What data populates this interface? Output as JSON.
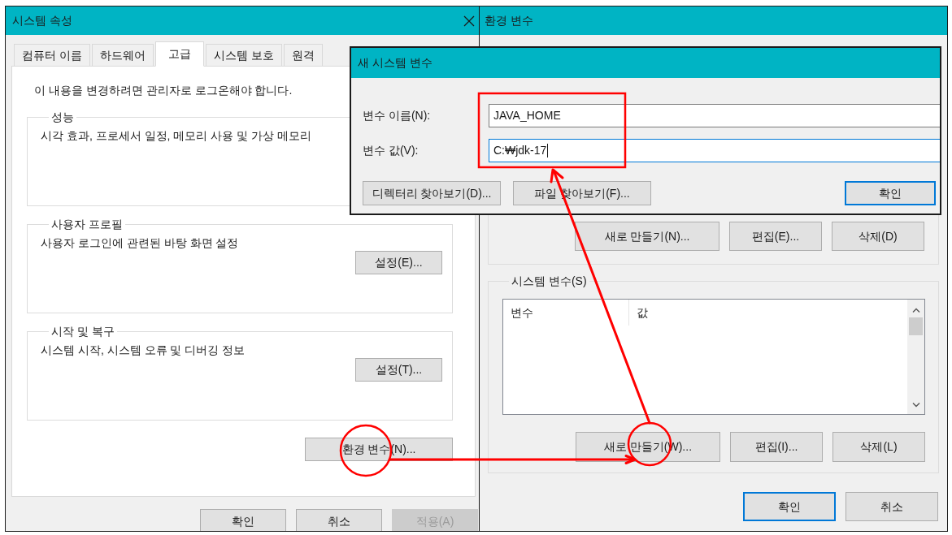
{
  "system_properties": {
    "title": "시스템 속성",
    "tabs": [
      {
        "label": "컴퓨터 이름",
        "selected": false
      },
      {
        "label": "하드웨어",
        "selected": false
      },
      {
        "label": "고급",
        "selected": true
      },
      {
        "label": "시스템 보호",
        "selected": false
      },
      {
        "label": "원격",
        "selected": false
      }
    ],
    "notice": "이 내용을 변경하려면 관리자로 로그온해야 합니다.",
    "groups": [
      {
        "title": "성능",
        "description": "시각 효과, 프로세서 일정, 메모리 사용 및 가상 메모리"
      },
      {
        "title": "사용자 프로필",
        "description": "사용자 로그인에 관련된 바탕 화면 설정",
        "button": "설정(E)..."
      },
      {
        "title": "시작 및 복구",
        "description": "시스템 시작, 시스템 오류 및 디버깅 정보",
        "button": "설정(T)..."
      }
    ],
    "environment_button": "환경 변수(N)...",
    "buttons": [
      {
        "label": "확인",
        "disabled": false
      },
      {
        "label": "취소",
        "disabled": false
      },
      {
        "label": "적용(A)",
        "disabled": true
      }
    ]
  },
  "environment_variables": {
    "title": "환경 변수",
    "user_variable_buttons": [
      "새로 만들기(N)...",
      "편집(E)...",
      "삭제(D)"
    ],
    "system_variables": {
      "title": "시스템 변수(S)",
      "columns": [
        "변수",
        "값"
      ],
      "buttons": [
        "새로 만들기(W)...",
        "편집(I)...",
        "삭제(L)"
      ]
    },
    "buttons": [
      {
        "label": "확인",
        "default": true
      },
      {
        "label": "취소",
        "default": false
      }
    ]
  },
  "new_system_variable": {
    "title": "새 시스템 변수",
    "fields": [
      {
        "label": "변수 이름(N):",
        "value": "JAVA_HOME",
        "focused": false
      },
      {
        "label": "변수 값(V):",
        "value": "C:₩jdk-17",
        "focused": true
      }
    ],
    "browse_buttons": [
      "디렉터리 찾아보기(D)...",
      "파일 찾아보기(F)..."
    ],
    "ok_button": {
      "label": "확인",
      "default": true
    }
  }
}
